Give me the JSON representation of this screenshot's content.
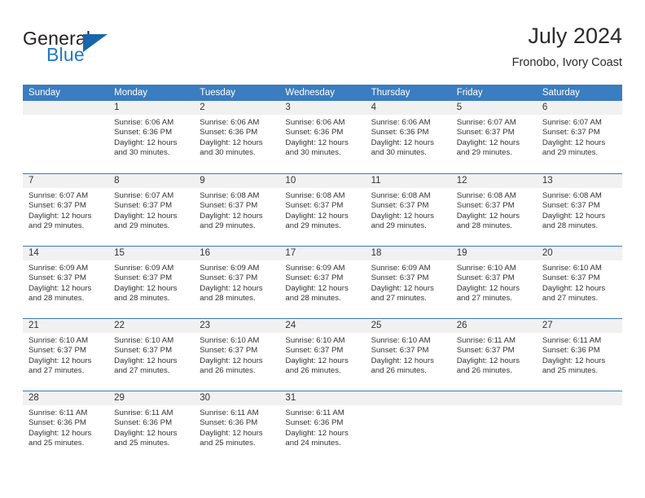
{
  "brand": {
    "name_top": "General",
    "name_bottom": "Blue",
    "flag_icon": "triangle-flag-icon",
    "accent_color": "#1f7ac4"
  },
  "header": {
    "title": "July 2024",
    "subtitle": "Fronobo, Ivory Coast"
  },
  "calendar": {
    "header_color": "#3a7dc0",
    "weekdays": [
      "Sunday",
      "Monday",
      "Tuesday",
      "Wednesday",
      "Thursday",
      "Friday",
      "Saturday"
    ],
    "weeks": [
      [
        {
          "day": "",
          "sunrise": "",
          "sunset": "",
          "daylight_1": "",
          "daylight_2": ""
        },
        {
          "day": "1",
          "sunrise": "Sunrise: 6:06 AM",
          "sunset": "Sunset: 6:36 PM",
          "daylight_1": "Daylight: 12 hours",
          "daylight_2": "and 30 minutes."
        },
        {
          "day": "2",
          "sunrise": "Sunrise: 6:06 AM",
          "sunset": "Sunset: 6:36 PM",
          "daylight_1": "Daylight: 12 hours",
          "daylight_2": "and 30 minutes."
        },
        {
          "day": "3",
          "sunrise": "Sunrise: 6:06 AM",
          "sunset": "Sunset: 6:36 PM",
          "daylight_1": "Daylight: 12 hours",
          "daylight_2": "and 30 minutes."
        },
        {
          "day": "4",
          "sunrise": "Sunrise: 6:06 AM",
          "sunset": "Sunset: 6:36 PM",
          "daylight_1": "Daylight: 12 hours",
          "daylight_2": "and 30 minutes."
        },
        {
          "day": "5",
          "sunrise": "Sunrise: 6:07 AM",
          "sunset": "Sunset: 6:37 PM",
          "daylight_1": "Daylight: 12 hours",
          "daylight_2": "and 29 minutes."
        },
        {
          "day": "6",
          "sunrise": "Sunrise: 6:07 AM",
          "sunset": "Sunset: 6:37 PM",
          "daylight_1": "Daylight: 12 hours",
          "daylight_2": "and 29 minutes."
        }
      ],
      [
        {
          "day": "7",
          "sunrise": "Sunrise: 6:07 AM",
          "sunset": "Sunset: 6:37 PM",
          "daylight_1": "Daylight: 12 hours",
          "daylight_2": "and 29 minutes."
        },
        {
          "day": "8",
          "sunrise": "Sunrise: 6:07 AM",
          "sunset": "Sunset: 6:37 PM",
          "daylight_1": "Daylight: 12 hours",
          "daylight_2": "and 29 minutes."
        },
        {
          "day": "9",
          "sunrise": "Sunrise: 6:08 AM",
          "sunset": "Sunset: 6:37 PM",
          "daylight_1": "Daylight: 12 hours",
          "daylight_2": "and 29 minutes."
        },
        {
          "day": "10",
          "sunrise": "Sunrise: 6:08 AM",
          "sunset": "Sunset: 6:37 PM",
          "daylight_1": "Daylight: 12 hours",
          "daylight_2": "and 29 minutes."
        },
        {
          "day": "11",
          "sunrise": "Sunrise: 6:08 AM",
          "sunset": "Sunset: 6:37 PM",
          "daylight_1": "Daylight: 12 hours",
          "daylight_2": "and 29 minutes."
        },
        {
          "day": "12",
          "sunrise": "Sunrise: 6:08 AM",
          "sunset": "Sunset: 6:37 PM",
          "daylight_1": "Daylight: 12 hours",
          "daylight_2": "and 28 minutes."
        },
        {
          "day": "13",
          "sunrise": "Sunrise: 6:08 AM",
          "sunset": "Sunset: 6:37 PM",
          "daylight_1": "Daylight: 12 hours",
          "daylight_2": "and 28 minutes."
        }
      ],
      [
        {
          "day": "14",
          "sunrise": "Sunrise: 6:09 AM",
          "sunset": "Sunset: 6:37 PM",
          "daylight_1": "Daylight: 12 hours",
          "daylight_2": "and 28 minutes."
        },
        {
          "day": "15",
          "sunrise": "Sunrise: 6:09 AM",
          "sunset": "Sunset: 6:37 PM",
          "daylight_1": "Daylight: 12 hours",
          "daylight_2": "and 28 minutes."
        },
        {
          "day": "16",
          "sunrise": "Sunrise: 6:09 AM",
          "sunset": "Sunset: 6:37 PM",
          "daylight_1": "Daylight: 12 hours",
          "daylight_2": "and 28 minutes."
        },
        {
          "day": "17",
          "sunrise": "Sunrise: 6:09 AM",
          "sunset": "Sunset: 6:37 PM",
          "daylight_1": "Daylight: 12 hours",
          "daylight_2": "and 28 minutes."
        },
        {
          "day": "18",
          "sunrise": "Sunrise: 6:09 AM",
          "sunset": "Sunset: 6:37 PM",
          "daylight_1": "Daylight: 12 hours",
          "daylight_2": "and 27 minutes."
        },
        {
          "day": "19",
          "sunrise": "Sunrise: 6:10 AM",
          "sunset": "Sunset: 6:37 PM",
          "daylight_1": "Daylight: 12 hours",
          "daylight_2": "and 27 minutes."
        },
        {
          "day": "20",
          "sunrise": "Sunrise: 6:10 AM",
          "sunset": "Sunset: 6:37 PM",
          "daylight_1": "Daylight: 12 hours",
          "daylight_2": "and 27 minutes."
        }
      ],
      [
        {
          "day": "21",
          "sunrise": "Sunrise: 6:10 AM",
          "sunset": "Sunset: 6:37 PM",
          "daylight_1": "Daylight: 12 hours",
          "daylight_2": "and 27 minutes."
        },
        {
          "day": "22",
          "sunrise": "Sunrise: 6:10 AM",
          "sunset": "Sunset: 6:37 PM",
          "daylight_1": "Daylight: 12 hours",
          "daylight_2": "and 27 minutes."
        },
        {
          "day": "23",
          "sunrise": "Sunrise: 6:10 AM",
          "sunset": "Sunset: 6:37 PM",
          "daylight_1": "Daylight: 12 hours",
          "daylight_2": "and 26 minutes."
        },
        {
          "day": "24",
          "sunrise": "Sunrise: 6:10 AM",
          "sunset": "Sunset: 6:37 PM",
          "daylight_1": "Daylight: 12 hours",
          "daylight_2": "and 26 minutes."
        },
        {
          "day": "25",
          "sunrise": "Sunrise: 6:10 AM",
          "sunset": "Sunset: 6:37 PM",
          "daylight_1": "Daylight: 12 hours",
          "daylight_2": "and 26 minutes."
        },
        {
          "day": "26",
          "sunrise": "Sunrise: 6:11 AM",
          "sunset": "Sunset: 6:37 PM",
          "daylight_1": "Daylight: 12 hours",
          "daylight_2": "and 26 minutes."
        },
        {
          "day": "27",
          "sunrise": "Sunrise: 6:11 AM",
          "sunset": "Sunset: 6:36 PM",
          "daylight_1": "Daylight: 12 hours",
          "daylight_2": "and 25 minutes."
        }
      ],
      [
        {
          "day": "28",
          "sunrise": "Sunrise: 6:11 AM",
          "sunset": "Sunset: 6:36 PM",
          "daylight_1": "Daylight: 12 hours",
          "daylight_2": "and 25 minutes."
        },
        {
          "day": "29",
          "sunrise": "Sunrise: 6:11 AM",
          "sunset": "Sunset: 6:36 PM",
          "daylight_1": "Daylight: 12 hours",
          "daylight_2": "and 25 minutes."
        },
        {
          "day": "30",
          "sunrise": "Sunrise: 6:11 AM",
          "sunset": "Sunset: 6:36 PM",
          "daylight_1": "Daylight: 12 hours",
          "daylight_2": "and 25 minutes."
        },
        {
          "day": "31",
          "sunrise": "Sunrise: 6:11 AM",
          "sunset": "Sunset: 6:36 PM",
          "daylight_1": "Daylight: 12 hours",
          "daylight_2": "and 24 minutes."
        },
        {
          "day": "",
          "sunrise": "",
          "sunset": "",
          "daylight_1": "",
          "daylight_2": ""
        },
        {
          "day": "",
          "sunrise": "",
          "sunset": "",
          "daylight_1": "",
          "daylight_2": ""
        },
        {
          "day": "",
          "sunrise": "",
          "sunset": "",
          "daylight_1": "",
          "daylight_2": ""
        }
      ]
    ]
  }
}
